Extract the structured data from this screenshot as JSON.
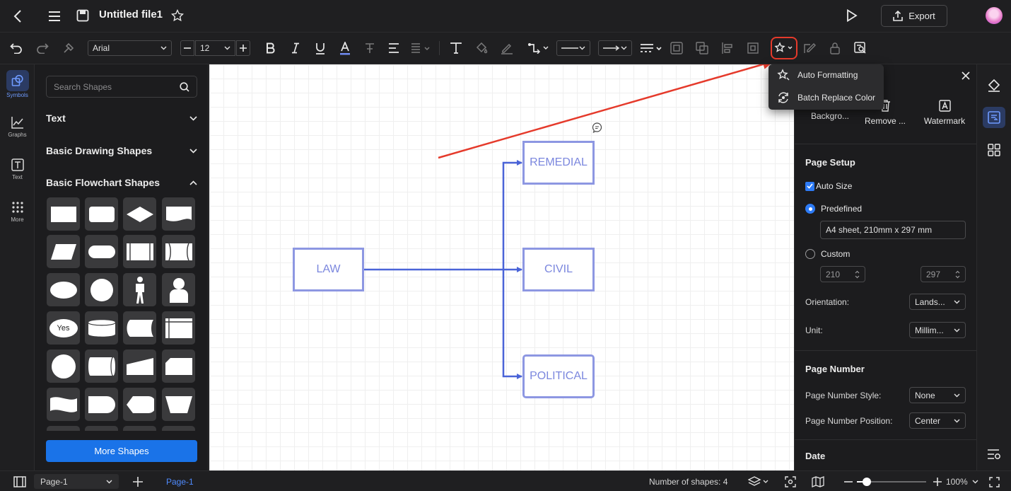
{
  "titlebar": {
    "title": "Untitled file1",
    "export_label": "Export",
    "icons": [
      "back-icon",
      "menu-icon",
      "save-icon",
      "star-icon",
      "play-icon",
      "export-icon",
      "avatar"
    ]
  },
  "toolbar": {
    "font_family": "Arial",
    "font_size": "12",
    "icons": [
      "undo-icon",
      "redo-icon",
      "format-painter-icon",
      "decrease-font-icon",
      "increase-font-icon",
      "bold-icon",
      "italic-icon",
      "underline-icon",
      "font-color-icon",
      "text-style-icon",
      "align-icon",
      "line-spacing-icon",
      "text-tool-icon",
      "fill-icon",
      "line-color-icon",
      "connector-icon",
      "line-style-icon",
      "arrow-style-icon",
      "line-weight-icon",
      "group-icon",
      "arrange-icon",
      "align-shapes-icon",
      "crop-icon",
      "auto-format-icon",
      "edit-icon",
      "lock-icon",
      "find-icon"
    ]
  },
  "dropdown_menu": {
    "items": [
      {
        "label": "Auto Formatting",
        "icon": "auto-format-icon"
      },
      {
        "label": "Batch Replace Color",
        "icon": "replace-color-icon"
      }
    ]
  },
  "left_rail": {
    "items": [
      {
        "label": "Symbols",
        "icon": "symbols-icon",
        "active": true
      },
      {
        "label": "Graphs",
        "icon": "graphs-icon"
      },
      {
        "label": "Text",
        "icon": "text-icon"
      },
      {
        "label": "More",
        "icon": "more-grid-icon"
      }
    ]
  },
  "shapes_panel": {
    "search_placeholder": "Search Shapes",
    "sections": [
      {
        "label": "Text",
        "expanded": false
      },
      {
        "label": "Basic Drawing Shapes",
        "expanded": false
      },
      {
        "label": "Basic Flowchart Shapes",
        "expanded": true
      }
    ],
    "yes_label": "Yes",
    "more_shapes_label": "More Shapes"
  },
  "canvas": {
    "nodes": [
      {
        "id": "law",
        "label": "LAW"
      },
      {
        "id": "remedial",
        "label": "REMEDIAL"
      },
      {
        "id": "civil",
        "label": "CIVIL"
      },
      {
        "id": "political",
        "label": "POLITICAL"
      }
    ],
    "colors": {
      "node_stroke": "#8d97e2",
      "connector": "#4a64d8",
      "annotation_arrow": "#e53a2b"
    }
  },
  "right_panel": {
    "tools": [
      {
        "label": "Backgro...",
        "icon": "background-icon"
      },
      {
        "label": "Remove ...",
        "icon": "remove-icon"
      },
      {
        "label": "Watermark",
        "icon": "watermark-icon"
      }
    ],
    "page_setup": {
      "title": "Page Setup",
      "auto_size_label": "Auto Size",
      "auto_size_checked": true,
      "predefined_label": "Predefined",
      "predefined_value": "A4 sheet, 210mm x 297 mm",
      "custom_label": "Custom",
      "width": "210",
      "height": "297",
      "orientation_label": "Orientation:",
      "orientation_value": "Lands...",
      "unit_label": "Unit:",
      "unit_value": "Millim..."
    },
    "page_number": {
      "title": "Page Number",
      "style_label": "Page Number Style:",
      "style_value": "None",
      "position_label": "Page Number Position:",
      "position_value": "Center"
    },
    "date": {
      "title": "Date"
    }
  },
  "right_rail": {
    "icons": [
      "style-fill-icon",
      "page-settings-icon",
      "layout-grid-icon",
      "more-settings-icon"
    ]
  },
  "statusbar": {
    "page_select": "Page-1",
    "page_tab": "Page-1",
    "shape_count": "Number of shapes: 4",
    "zoom": "100%"
  }
}
